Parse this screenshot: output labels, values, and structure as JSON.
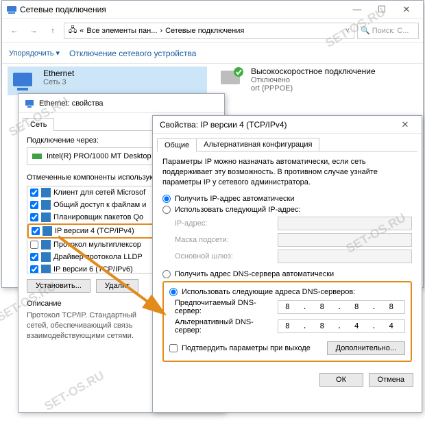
{
  "explorer": {
    "title": "Сетевые подключения",
    "breadcrumb_1": "Все элементы пан...",
    "breadcrumb_2": "Сетевые подключения",
    "search_placeholder": "Поиск: С...",
    "cmd_organize": "Упорядочить",
    "cmd_disable": "Отключение сетевого устройства",
    "ethernet": {
      "name": "Ethernet",
      "line2": "Сеть 3"
    },
    "pppoe": {
      "name": "Высокоскоростное подключение",
      "line2": "Отключено",
      "line3": "ort (PPPOE)"
    }
  },
  "props1": {
    "title": "Ethernet: свойства",
    "tab_net": "Сеть",
    "lbl_connects": "Подключение через:",
    "adapter": "Intel(R) PRO/1000 MT Desktop",
    "lbl_components": "Отмеченные компоненты использую",
    "items": [
      "Клиент для сетей Microsof",
      "Общий доступ к файлам и",
      "Планировщик пакетов Qo",
      "IP версии 4 (TCP/IPv4)",
      "Протокол мультиплексор",
      "Драйвер протокола LLDP",
      "IP версии 6 (TCP/IPv6)"
    ],
    "btn_install": "Установить...",
    "btn_remove": "Удалит",
    "lbl_desc": "Описание",
    "desc": "Протокол TCP/IP. Стандартный\nсетей, обеспечивающий связь\nвзаимодействующими сетями."
  },
  "props2": {
    "title": "Свойства: IP версии 4 (TCP/IPv4)",
    "tab_general": "Общие",
    "tab_alt": "Альтернативная конфигурация",
    "para": "Параметры IP можно назначать автоматически, если сеть поддерживает эту возможность. В противном случае узнайте параметры IP у сетевого администратора.",
    "r_ip_auto": "Получить IP-адрес автоматически",
    "r_ip_manual": "Использовать следующий IP-адрес:",
    "f_ip": "IP-адрес:",
    "f_mask": "Маска подсети:",
    "f_gw": "Основной шлюз:",
    "r_dns_auto": "Получить адрес DNS-сервера автоматически",
    "r_dns_manual": "Использовать следующие адреса DNS-серверов:",
    "f_dns1": "Предпочитаемый DNS-сервер:",
    "f_dns2": "Альтернативный DNS-сервер:",
    "v_dns1": "8 . 8 . 8 . 8",
    "v_dns2": "8 . 8 . 4 . 4",
    "chk_validate": "Подтвердить параметры при выходе",
    "btn_adv": "Дополнительно...",
    "btn_ok": "ОК",
    "btn_cancel": "Отмена"
  },
  "watermark": "SET-OS.RU"
}
